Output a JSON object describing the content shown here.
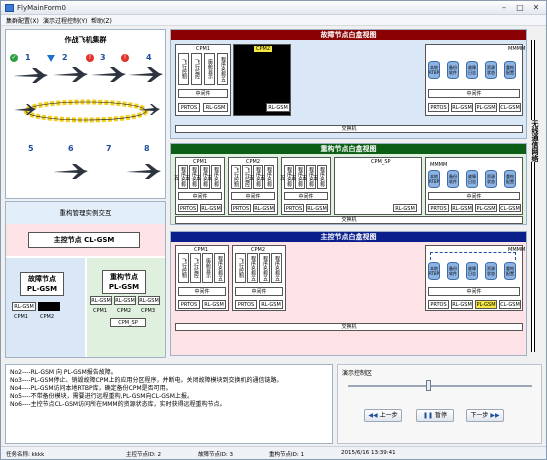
{
  "window": {
    "title": "FlyMainForm0",
    "min": "–",
    "max": "□",
    "close": "✕"
  },
  "menu": {
    "items": [
      "集群配置(X)",
      "演示过程控制(Y)",
      "帮助(Z)"
    ]
  },
  "left_panel": {
    "title": "作战飞机集群",
    "top_numbers": [
      "1",
      "2",
      "3",
      "4"
    ],
    "bottom_numbers": [
      "5",
      "6",
      "7",
      "8"
    ],
    "status_icons": [
      "check-icon",
      "down-arrow-icon",
      "error-icon",
      "error-icon"
    ]
  },
  "reconfig_panel": {
    "title": "重构管理实例交互",
    "master": "主控节点 CL-GSM",
    "fault_node": "故障节点\nPL-GSM",
    "recon_node": "重构节点\nPL-GSM",
    "fault_boxes": [
      "RL-GSM",
      ""
    ],
    "fault_cpms": [
      "CPM1",
      "CPM2"
    ],
    "recon_boxes": [
      "RL-GSM",
      "RL-GSM",
      "RL-GSM"
    ],
    "recon_cpms": [
      "CPM1",
      "CPM2",
      "CPM3"
    ],
    "cpm_sp": "CPM_SP"
  },
  "sections": {
    "fault": {
      "title": "故障节点白盒视图",
      "color": "#8b0000",
      "bg": "#d9e7f7"
    },
    "recon": {
      "title": "重构节点白盒视图",
      "color": "#0b5e14",
      "bg": "#dff0df"
    },
    "master": {
      "title": "主控节点白盒视图",
      "color": "#0a1f8c",
      "bg": "#fde3e6"
    }
  },
  "labels": {
    "cpm1": "CPM1",
    "cpm2": "CPM2",
    "cpm_sp": "CPM_SP",
    "mmm": "MMMM",
    "middleware": "中间件",
    "prtos": "PRTOS",
    "rlgsm": "RL-GSM",
    "plgsm": "PL-GSM",
    "clgsm": "CL-GSM",
    "switch": "交换机",
    "app1": "飞行控制",
    "app2": "飞行监控",
    "app3": "座舱显示",
    "prog": "程序名称五",
    "db": [
      "本地RTBP",
      "备份软件",
      "故障日志",
      "资源状态",
      "重构配置"
    ]
  },
  "rail_text": "无线通信网络",
  "log_lines": [
    "No2----RL-GSM 向 PL-GSM报告故障。",
    "No3----PL-GSM停止、销毁故障CPM上的应用分区程序，并断电，关闭故障模块到交换机的通信链路。",
    "No4----PL-GSM访问本地RTBP库，确定备份CPM是否可用。",
    "No5----不带备份模块，需要进行远程重构,PL-GSM向CL-GSM上报。",
    "No6----主控节点CL-GSM访问所在MMM的资源状态库，实时获得远程重构节点。"
  ],
  "control": {
    "title": "演示控制区",
    "prev": "上一步",
    "pause": "暂停",
    "next": "下一步",
    "slider_value": 0.42
  },
  "status": {
    "task": "任务名称: kkkk",
    "master": "主控节点ID: 2",
    "fault": "故障节点ID: 3",
    "recon": "重构节点ID: 1",
    "time": "2015/6/16 13:39:41"
  }
}
